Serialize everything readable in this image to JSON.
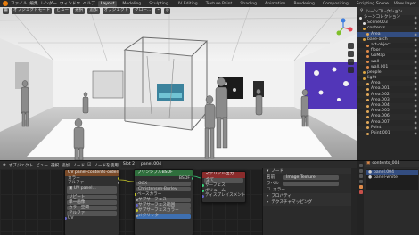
{
  "topbar": {
    "menus": [
      "ファイル",
      "編集",
      "レンダー",
      "ウィンドウ",
      "ヘルプ"
    ],
    "workspaces": [
      "Layout",
      "Modeling",
      "Sculpting",
      "UV Editing",
      "Texture Paint",
      "Shading",
      "Animation",
      "Rendering",
      "Compositing",
      "Scripting"
    ],
    "active_workspace": "Layout",
    "scene": "Scene",
    "view_layer": "View Layer"
  },
  "viewport": {
    "mode": "オブジェクトモード",
    "menus": [
      "ビュー",
      "選択",
      "追加",
      "オブジェクト"
    ],
    "orientation": "グロー...",
    "gizmo_axes": [
      "X",
      "Y",
      "Z"
    ],
    "colors": {
      "axis_x": "#e8414f",
      "axis_y": "#7fbf2a",
      "axis_z": "#3f7fe0"
    }
  },
  "outliner": {
    "title": "シーンコレクション",
    "rows": [
      {
        "label": "シーンコレクション",
        "indent": 0,
        "color": "#dddddd"
      },
      {
        "label": "Scene003",
        "indent": 1,
        "color": "#dddddd"
      },
      {
        "label": "contents",
        "indent": 1,
        "color": "#d9a441"
      },
      {
        "label": "Area",
        "indent": 2,
        "color": "#e0a85a"
      },
      {
        "label": "base-arch",
        "indent": 1,
        "color": "#d9a441"
      },
      {
        "label": "art-object",
        "indent": 2,
        "color": "#e08b4a"
      },
      {
        "label": "floor",
        "indent": 2,
        "color": "#e08b4a"
      },
      {
        "label": "GoMap",
        "indent": 2,
        "color": "#e08b4a"
      },
      {
        "label": "wall",
        "indent": 2,
        "color": "#e08b4a"
      },
      {
        "label": "wall.001",
        "indent": 2,
        "color": "#e08b4a"
      },
      {
        "label": "people",
        "indent": 1,
        "color": "#d9a441"
      },
      {
        "label": "light",
        "indent": 1,
        "color": "#d9a441"
      },
      {
        "label": "Area",
        "indent": 2,
        "color": "#e0a85a"
      },
      {
        "label": "Area.001",
        "indent": 2,
        "color": "#e0a85a"
      },
      {
        "label": "Area.002",
        "indent": 2,
        "color": "#e0a85a"
      },
      {
        "label": "Area.003",
        "indent": 2,
        "color": "#e0a85a"
      },
      {
        "label": "Area.004",
        "indent": 2,
        "color": "#e0a85a"
      },
      {
        "label": "Area.005",
        "indent": 2,
        "color": "#e0a85a"
      },
      {
        "label": "Area.006",
        "indent": 2,
        "color": "#e0a85a"
      },
      {
        "label": "Area.007",
        "indent": 2,
        "color": "#e0a85a"
      },
      {
        "label": "Point",
        "indent": 2,
        "color": "#e0a85a"
      },
      {
        "label": "Point.001",
        "indent": 2,
        "color": "#e0a85a"
      }
    ],
    "selected_index": 3
  },
  "node_editor": {
    "menus": [
      "オブジェクト",
      "ビュー",
      "選択",
      "追加",
      "ノード"
    ],
    "use_nodes_label": "ノードを使用",
    "slot": "Slot 2",
    "material": "panel.004",
    "nodes": {
      "tex_coord": {
        "title": "UV panel-contents-orderby.pb",
        "rows": [
          "カラー",
          "アルファ",
          "リピート",
          "単一画像",
          "カラー空間",
          "アルファ",
          "UV"
        ]
      },
      "bsdf": {
        "title": "プリンシプルBSDF",
        "rows": [
          "BSDF",
          "GGX",
          "Christensen-Burley",
          "ベースカラー",
          "サブサーフェス",
          "サブサーフェス範囲",
          "サブサーフェスカラー",
          "メタリック"
        ]
      },
      "output": {
        "title": "マテリアル出力",
        "rows": [
          "全て",
          "サーフェス",
          "ボリューム",
          "ディスプレイスメント"
        ]
      }
    }
  },
  "npanel": {
    "section": "ノード",
    "name_label": "名前",
    "name_value": "Image Texture",
    "label_label": "ラベル",
    "color_label": "カラー",
    "properties_label": "プロパティ",
    "texture_mapping_label": "テクスチャマッピング"
  },
  "properties": {
    "object_name": "contents_004",
    "slots": [
      "panel.004",
      "panel-white"
    ],
    "selected_slot": 0
  }
}
